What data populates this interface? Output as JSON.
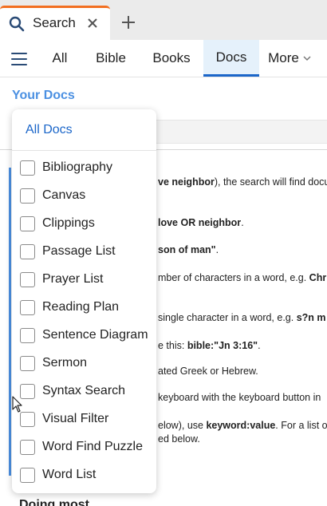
{
  "tab": {
    "label": "Search"
  },
  "nav": {
    "tabs": [
      {
        "label": "All"
      },
      {
        "label": "Bible"
      },
      {
        "label": "Books"
      },
      {
        "label": "Docs",
        "active": true
      },
      {
        "label": "More"
      }
    ]
  },
  "content": {
    "section_title": "Your Docs",
    "help_lines": [
      {
        "bold_lead": "ve neighbor",
        "text": "), the search will find docu"
      },
      {
        "bold_lead": " love OR neighbor",
        "text": "."
      },
      {
        "bold_lead": "son of man\"",
        "text": "."
      },
      {
        "text": "mber of characters in a word, e.g. ",
        "bold_tail": "Chr"
      },
      {
        "text": " single character in a word, e.g. ",
        "bold_tail": "s?n m"
      },
      {
        "text": "e this: ",
        "bold_tail": "bible:\"Jn 3:16\"",
        "tail": "."
      },
      {
        "text": "ated Greek or Hebrew."
      },
      {
        "text": "keyboard with the keyboard button in"
      },
      {
        "text": "elow), use ",
        "bold_tail": "keyword:value",
        "tail": ". For a list o"
      },
      {
        "text": "ed below."
      }
    ],
    "bottom_heading": "Doing most"
  },
  "dropdown": {
    "all_label": "All Docs",
    "options": [
      "Bibliography",
      "Canvas",
      "Clippings",
      "Passage List",
      "Prayer List",
      "Reading Plan",
      "Sentence Diagram",
      "Sermon",
      "Syntax Search",
      "Visual Filter",
      "Word Find Puzzle",
      "Word List"
    ]
  },
  "colors": {
    "accent": "#1b66c9",
    "tab_accent": "#f26f21",
    "link_blue": "#4b90e2"
  },
  "icons": {
    "tab": "search-icon",
    "close": "close-icon",
    "new_tab": "plus-icon",
    "menu": "hamburger-icon",
    "more": "chevron-down-icon"
  }
}
